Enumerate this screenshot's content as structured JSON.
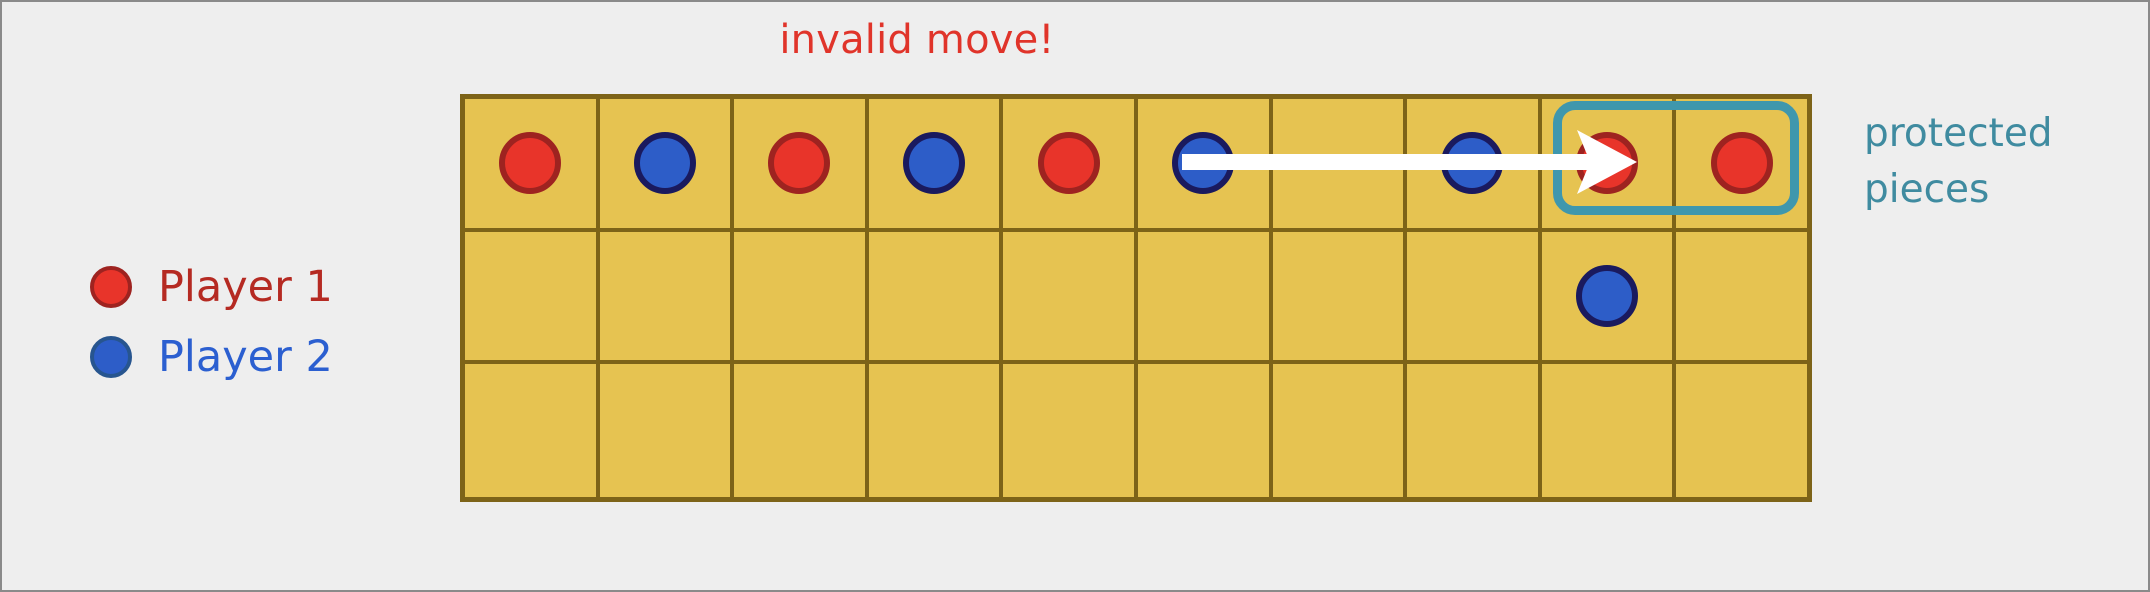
{
  "status": {
    "message": "invalid move!",
    "color": "#e0342a"
  },
  "legend": {
    "items": [
      {
        "label": "Player 1",
        "color": "#e8342a",
        "text_color": "#b52a22",
        "icon": "red-circle-icon"
      },
      {
        "label": "Player 2",
        "color": "#2d5dc8",
        "text_color": "#2b5fd0",
        "icon": "blue-circle-icon"
      }
    ]
  },
  "annotation": {
    "protected_label_line1": "protected",
    "protected_label_line2": "pieces",
    "protected_color": "#3f8ba0",
    "highlight_color": "#3f97ad",
    "highlight_columns": [
      9,
      10
    ]
  },
  "board": {
    "rows": 3,
    "columns": 10,
    "cell_color": "#e6c351",
    "grid_line_color": "#7d6318",
    "cells": [
      [
        "p1",
        "p2",
        "p1",
        "p2",
        "p1",
        "p2",
        "",
        "p2",
        "p1",
        "p1"
      ],
      [
        "",
        "",
        "",
        "",
        "",
        "",
        "",
        "",
        "p2",
        ""
      ],
      [
        "",
        "",
        "",
        "",
        "",
        "",
        "",
        "",
        "",
        ""
      ]
    ]
  },
  "move_arrow": {
    "from_row": 1,
    "from_column": 6,
    "to_row": 1,
    "to_column": 9,
    "color": "#ffffff"
  }
}
